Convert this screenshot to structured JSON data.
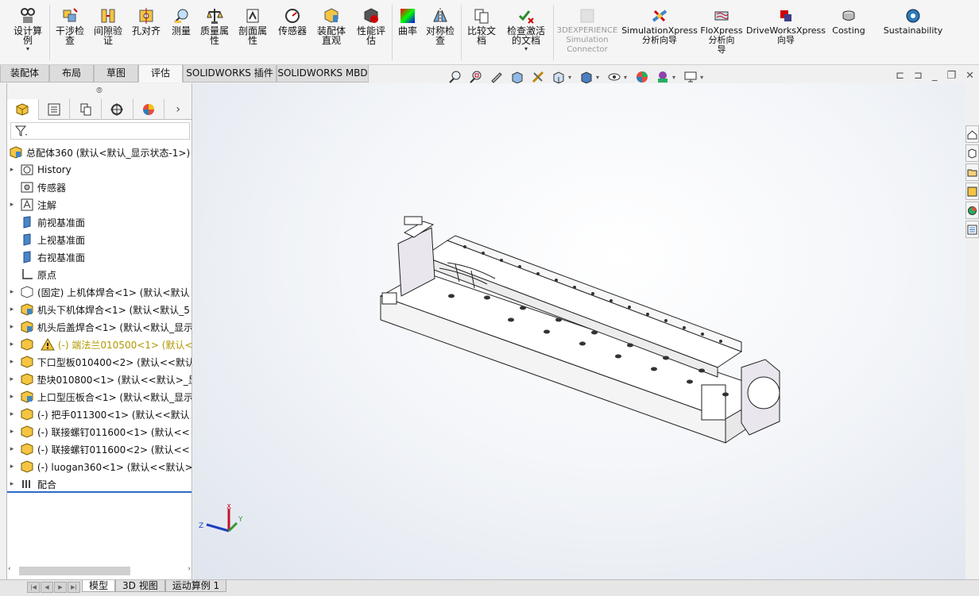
{
  "ribbon": {
    "buttons": [
      {
        "label": "设计算\n例",
        "icon": "design-table-icon"
      },
      {
        "label": "干涉检\n查",
        "icon": "interference-icon"
      },
      {
        "label": "间隙验\n证",
        "icon": "clearance-icon"
      },
      {
        "label": "孔对齐",
        "icon": "hole-align-icon"
      },
      {
        "label": "测量",
        "icon": "measure-icon"
      },
      {
        "label": "质量属\n性",
        "icon": "mass-props-icon"
      },
      {
        "label": "剖面属\n性",
        "icon": "section-props-icon"
      },
      {
        "label": "传感器",
        "icon": "sensor-icon"
      },
      {
        "label": "装配体\n直观",
        "icon": "assembly-visual-icon"
      },
      {
        "label": "性能评\n估",
        "icon": "performance-icon"
      },
      {
        "label": "曲率",
        "icon": "curvature-icon"
      },
      {
        "label": "对称检\n查",
        "icon": "symmetry-icon"
      },
      {
        "label": "比较文\n档",
        "icon": "compare-icon"
      },
      {
        "label": "检查激活\n的文档",
        "icon": "check-doc-icon"
      },
      {
        "label": "3DEXPERIENCE\nSimulation\nConnector",
        "icon": "3dx-icon"
      },
      {
        "label": "SimulationXpress\n分析向导",
        "icon": "simxpress-icon"
      },
      {
        "label": "FloXpress\n分析向\n导",
        "icon": "floxpress-icon"
      },
      {
        "label": "DriveWorksXpress\n向导",
        "icon": "driveworks-icon"
      },
      {
        "label": "Costing",
        "icon": "costing-icon"
      },
      {
        "label": "Sustainability",
        "icon": "sustainability-icon"
      }
    ]
  },
  "tabs": [
    "装配体",
    "布局",
    "草图",
    "评估",
    "SOLIDWORKS 插件",
    "SOLIDWORKS MBD"
  ],
  "tree": {
    "root": "总配体360  (默认<默认_显示状态-1>)",
    "items": [
      {
        "label": "History",
        "expand": true
      },
      {
        "label": "传感器",
        "expand": false
      },
      {
        "label": "注解",
        "expand": true
      },
      {
        "label": "前视基准面",
        "expand": false
      },
      {
        "label": "上视基准面",
        "expand": false
      },
      {
        "label": "右视基准面",
        "expand": false
      },
      {
        "label": "原点",
        "expand": false
      },
      {
        "label": "(固定) 上机体焊合<1> (默认<默认",
        "expand": true
      },
      {
        "label": "机头下机体焊合<1> (默认<默认_5",
        "expand": true
      },
      {
        "label": "机头后盖焊合<1> (默认<默认_显示",
        "expand": true
      },
      {
        "label": "(-) 端法兰010500<1> (默认<",
        "expand": true,
        "warning": true
      },
      {
        "label": "下口型板010400<2> (默认<<默认",
        "expand": true
      },
      {
        "label": "垫块010800<1> (默认<<默认>_显",
        "expand": true
      },
      {
        "label": "上口型压板合<1> (默认<默认_显示",
        "expand": true
      },
      {
        "label": "(-) 把手011300<1> (默认<<默认",
        "expand": true
      },
      {
        "label": "(-) 联接螺钉011600<1> (默认<<",
        "expand": true
      },
      {
        "label": "(-) 联接螺钉011600<2> (默认<<",
        "expand": true
      },
      {
        "label": "(-) luogan360<1> (默认<<默认>",
        "expand": true
      },
      {
        "label": "配合",
        "expand": true
      }
    ]
  },
  "bottom_tabs": [
    "模型",
    "3D 视图",
    "运动算例 1"
  ],
  "triad": {
    "x": "X",
    "y": "Y",
    "z": "Z"
  },
  "colors": {
    "accent": "#2b6cc4",
    "warning": "#b29900"
  }
}
